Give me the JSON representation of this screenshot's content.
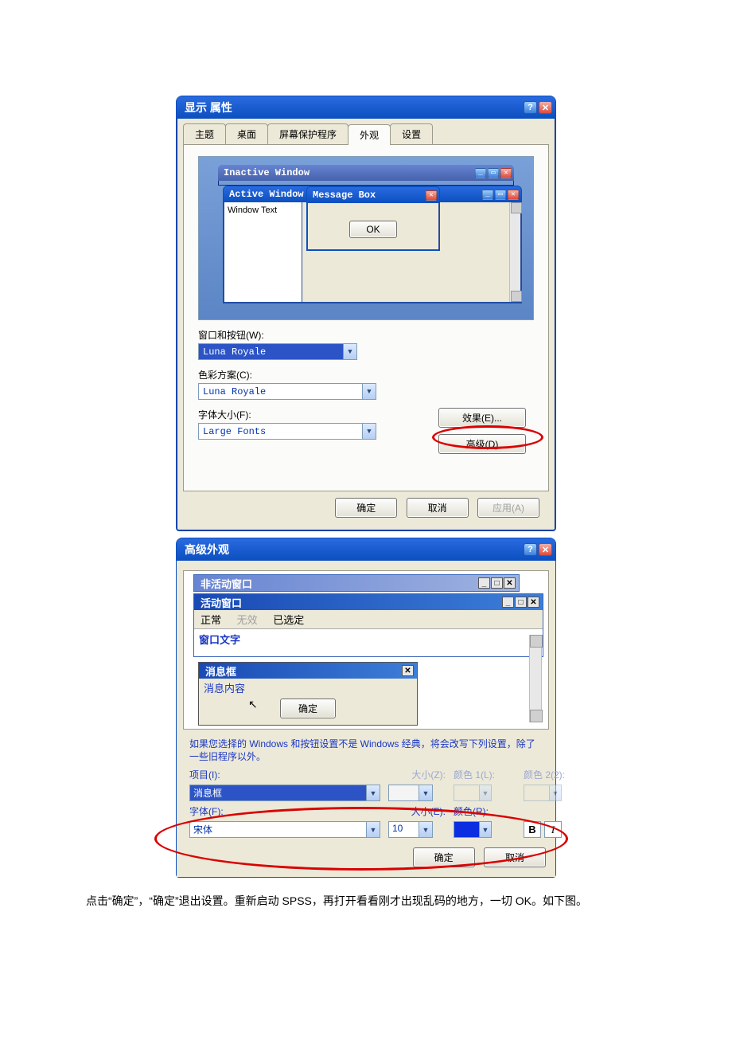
{
  "dlg1": {
    "title": "显示 属性",
    "tabs": [
      "主题",
      "桌面",
      "屏幕保护程序",
      "外观",
      "设置"
    ],
    "active_tab": 3,
    "preview": {
      "inactive_title": "Inactive Window",
      "active_title": "Active Window",
      "window_text": "Window Text",
      "msgbox_title": "Message Box",
      "msgbox_ok": "OK"
    },
    "labels": {
      "windows_buttons": "窗口和按钮(W):",
      "color_scheme": "色彩方案(C):",
      "font_size": "字体大小(F):"
    },
    "values": {
      "windows_buttons": "Luna Royale",
      "color_scheme": "Luna Royale",
      "font_size": "Large Fonts"
    },
    "buttons": {
      "effects": "效果(E)...",
      "advanced": "高级(D)",
      "ok": "确定",
      "cancel": "取消",
      "apply": "应用(A)"
    }
  },
  "dlg2": {
    "title": "高级外观",
    "preview": {
      "inactive_title": "非活动窗口",
      "active_title": "活动窗口",
      "menu_normal": "正常",
      "menu_disabled": "无效",
      "menu_selected": "已选定",
      "window_text": "窗口文字",
      "msgbox_title": "消息框",
      "msgbox_text": "消息内容",
      "msgbox_ok": "确定"
    },
    "hint": "如果您选择的 Windows 和按钮设置不是 Windows 经典，将会改写下列设置，除了一些旧程序以外。",
    "labels": {
      "item": "项目(I):",
      "size1": "大小(Z):",
      "color1": "颜色 1(L):",
      "color2": "颜色 2(2):",
      "font": "字体(F):",
      "size2": "大小(E):",
      "color_r": "颜色(R):"
    },
    "values": {
      "item": "消息框",
      "size1": "",
      "font": "宋体",
      "size2": "10",
      "color_r": "#0b2fe0"
    },
    "bi": {
      "bold": "B",
      "italic": "I"
    },
    "buttons": {
      "ok": "确定",
      "cancel": "取消"
    }
  },
  "footer": "点击“确定”，“确定”退出设置。重新启动 SPSS，再打开看看刚才出现乱码的地方，一切 OK。如下图。"
}
